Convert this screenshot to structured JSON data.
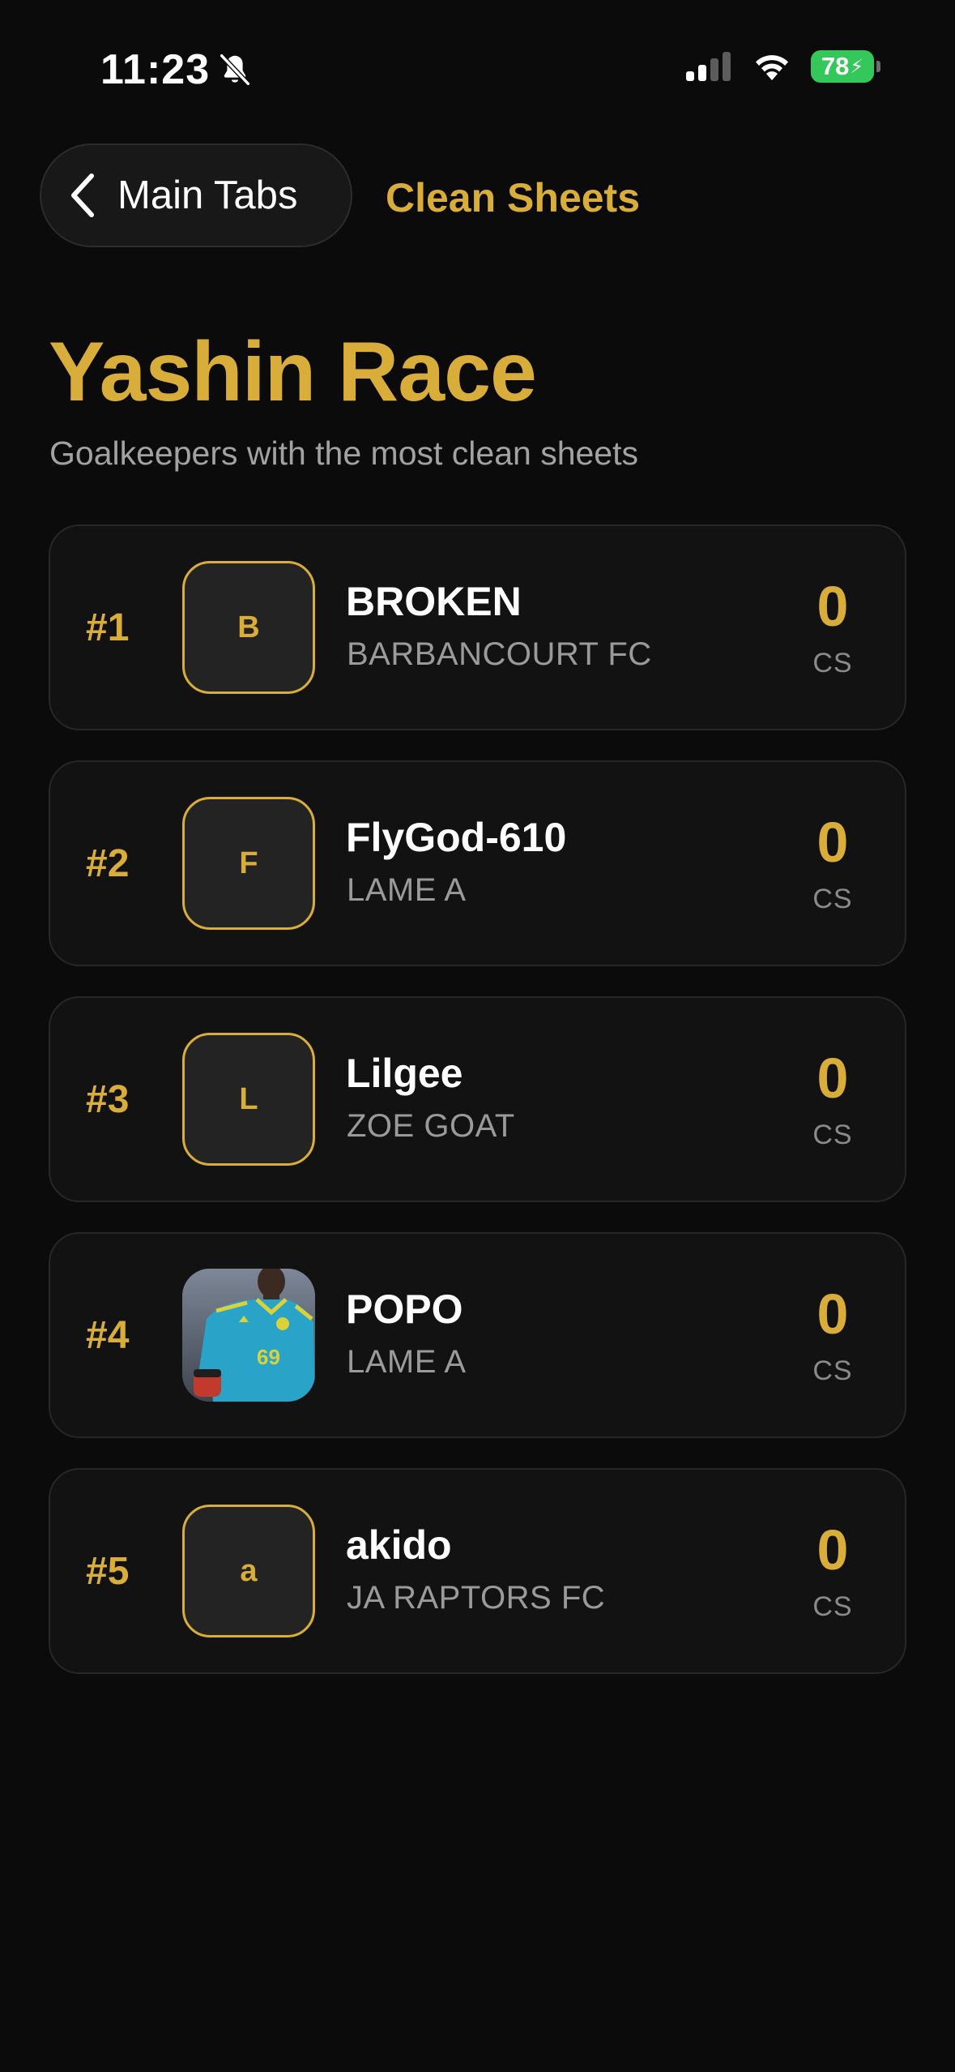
{
  "status_bar": {
    "time": "11:23",
    "battery": "78",
    "icons": [
      "bell-slash-icon",
      "cellular-signal-icon",
      "wifi-icon",
      "battery-charging-icon"
    ]
  },
  "nav": {
    "back_label": "Main Tabs",
    "back_icon": "chevron-left-icon",
    "title": "Clean Sheets"
  },
  "header": {
    "title": "Yashin Race",
    "subtitle": "Goalkeepers with the most clean sheets"
  },
  "colors": {
    "accent": "#d8ad3a",
    "background": "#0b0b0b",
    "card": "#121212",
    "battery": "#34c759"
  },
  "leaderboard": [
    {
      "rank": "#1",
      "initial": "B",
      "has_photo": false,
      "name": "BROKEN",
      "club": "BARBANCOURT FC",
      "value": "0",
      "unit": "CS"
    },
    {
      "rank": "#2",
      "initial": "F",
      "has_photo": false,
      "name": "FlyGod-610",
      "club": "LAME A",
      "value": "0",
      "unit": "CS"
    },
    {
      "rank": "#3",
      "initial": "L",
      "has_photo": false,
      "name": "Lilgee",
      "club": "ZOE GOAT",
      "value": "0",
      "unit": "CS"
    },
    {
      "rank": "#4",
      "initial": "",
      "has_photo": true,
      "name": "POPO",
      "club": "LAME A",
      "value": "0",
      "unit": "CS"
    },
    {
      "rank": "#5",
      "initial": "a",
      "has_photo": false,
      "name": "akido",
      "club": "JA RAPTORS  FC",
      "value": "0",
      "unit": "CS"
    }
  ]
}
